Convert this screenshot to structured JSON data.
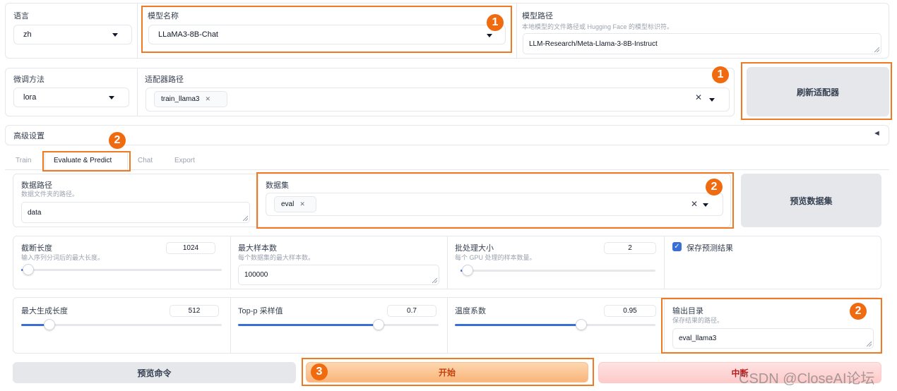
{
  "top": {
    "lang_label": "语言",
    "lang_value": "zh",
    "model_name_label": "模型名称",
    "model_name_value": "LLaMA3-8B-Chat",
    "model_path_label": "模型路径",
    "model_path_hint": "本地模型的文件路径或 Hugging Face 的模型标识符。",
    "model_path_value": "LLM-Research/Meta-Llama-3-8B-Instruct"
  },
  "finetune": {
    "method_label": "微调方法",
    "method_value": "lora",
    "adapter_label": "适配器路径",
    "adapter_tag": "train_llama3",
    "refresh_label": "刷新适配器"
  },
  "advanced": {
    "label": "高级设置",
    "arrow": "◄"
  },
  "tabs": [
    "Train",
    "Evaluate & Predict",
    "Chat",
    "Export"
  ],
  "eval": {
    "data_dir_label": "数据路径",
    "data_dir_hint": "数据文件夹的路径。",
    "data_dir_value": "data",
    "dataset_label": "数据集",
    "dataset_tag": "eval",
    "preview_dataset_label": "预览数据集",
    "cutoff_label": "截断长度",
    "cutoff_hint": "输入序列分词后的最大长度。",
    "cutoff_value": "1024",
    "cutoff_level": 0.0,
    "max_samples_label": "最大样本数",
    "max_samples_hint": "每个数据集的最大样本数。",
    "max_samples_value": "100000",
    "batch_label": "批处理大小",
    "batch_hint": "每个 GPU 处理的样本数量。",
    "batch_value": "2",
    "batch_level": 0.0,
    "save_pred_label": "保存预测结果",
    "max_new_tokens_label": "最大生成长度",
    "max_new_tokens_value": "512",
    "max_new_tokens_level": 0.14,
    "top_p_label": "Top-p 采样值",
    "top_p_value": "0.7",
    "top_p_level": 0.7,
    "temp_label": "温度系数",
    "temp_value": "0.95",
    "temp_level": 0.63,
    "output_dir_label": "输出目录",
    "output_dir_hint": "保存结果的路径。",
    "output_dir_value": "eval_llama3"
  },
  "actions": {
    "preview_cmd": "预览命令",
    "start": "开始",
    "abort": "中断"
  },
  "annotations": {
    "b1": "1",
    "b1b": "1",
    "b2a": "2",
    "b2b": "2",
    "b2c": "2",
    "b3": "3"
  },
  "watermark": "CSDN @CloseAI论坛",
  "colors": {
    "accent_blue": "#3b6fd8",
    "annotation_orange": "#f07922",
    "start_button": "#fbbf87",
    "abort_button": "#fecaca"
  }
}
